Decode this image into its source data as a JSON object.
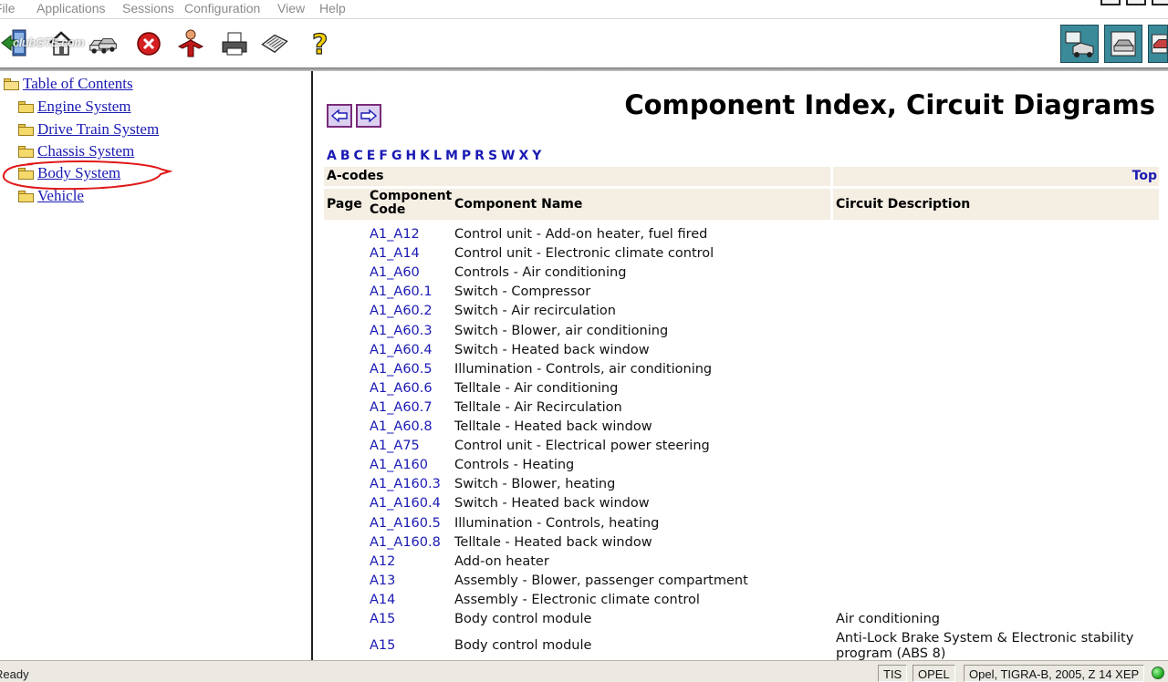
{
  "menu": [
    "File",
    "Applications",
    "Sessions",
    "Configuration",
    "View",
    "Help"
  ],
  "toolbar": {
    "watermark": "clubGTE.com",
    "icons": [
      "exit-icon",
      "home-icon",
      "vehicles-icon",
      "stop-icon",
      "person-icon",
      "print-icon",
      "notes-icon",
      "help-icon",
      "diagnostics-icon",
      "vehicle-scan-icon",
      "vehicle-settings-icon"
    ]
  },
  "tree": {
    "root": "Table of Contents",
    "items": [
      "Engine System",
      "Drive Train System",
      "Chassis System",
      "Body System",
      "Vehicle"
    ]
  },
  "content": {
    "title": "Component Index, Circuit Diagrams",
    "alphabet": [
      "A",
      "B",
      "C",
      "E",
      "F",
      "G",
      "H",
      "K",
      "L",
      "M",
      "P",
      "R",
      "S",
      "W",
      "X",
      "Y"
    ],
    "section": "A-codes",
    "top_link": "Top",
    "columns": {
      "page": "Page",
      "code_line1": "Component",
      "code_line2": "Code",
      "name": "Component Name",
      "desc": "Circuit Description"
    },
    "rows": [
      {
        "code": "A1_A12",
        "name": "Control unit - Add-on heater, fuel fired",
        "desc": ""
      },
      {
        "code": "A1_A14",
        "name": "Control unit - Electronic climate control",
        "desc": ""
      },
      {
        "code": "A1_A60",
        "name": "Controls - Air conditioning",
        "desc": ""
      },
      {
        "code": "A1_A60.1",
        "name": "Switch - Compressor",
        "desc": ""
      },
      {
        "code": "A1_A60.2",
        "name": "Switch - Air recirculation",
        "desc": ""
      },
      {
        "code": "A1_A60.3",
        "name": "Switch - Blower, air conditioning",
        "desc": ""
      },
      {
        "code": "A1_A60.4",
        "name": "Switch - Heated back window",
        "desc": ""
      },
      {
        "code": "A1_A60.5",
        "name": "Illumination - Controls, air conditioning",
        "desc": ""
      },
      {
        "code": "A1_A60.6",
        "name": "Telltale - Air conditioning",
        "desc": ""
      },
      {
        "code": "A1_A60.7",
        "name": "Telltale - Air Recirculation",
        "desc": ""
      },
      {
        "code": "A1_A60.8",
        "name": "Telltale - Heated back window",
        "desc": ""
      },
      {
        "code": "A1_A75",
        "name": "Control unit - Electrical power steering",
        "desc": ""
      },
      {
        "code": "A1_A160",
        "name": "Controls - Heating",
        "desc": ""
      },
      {
        "code": "A1_A160.3",
        "name": "Switch - Blower, heating",
        "desc": ""
      },
      {
        "code": "A1_A160.4",
        "name": "Switch - Heated back window",
        "desc": ""
      },
      {
        "code": "A1_A160.5",
        "name": "Illumination - Controls, heating",
        "desc": ""
      },
      {
        "code": "A1_A160.8",
        "name": "Telltale - Heated back window",
        "desc": ""
      },
      {
        "code": "A12",
        "name": "Add-on heater",
        "desc": ""
      },
      {
        "code": "A13",
        "name": "Assembly - Blower, passenger compartment",
        "desc": ""
      },
      {
        "code": "A14",
        "name": "Assembly - Electronic climate control",
        "desc": ""
      },
      {
        "code": "A15",
        "name": "Body control module",
        "desc": "Air conditioning"
      },
      {
        "code": "A15",
        "name": "Body control module",
        "desc": "Anti-Lock Brake System & Electronic stability program (ABS 8)"
      }
    ]
  },
  "status": {
    "text": "Ready",
    "fields": [
      "TIS",
      "OPEL",
      "Opel, TIGRA-B, 2005, Z 14 XEP"
    ],
    "led_color": "#1aa31a"
  },
  "colors": {
    "link": "#1a1ab4",
    "highlight_circle": "#e01818",
    "band": "#f4eee3"
  }
}
